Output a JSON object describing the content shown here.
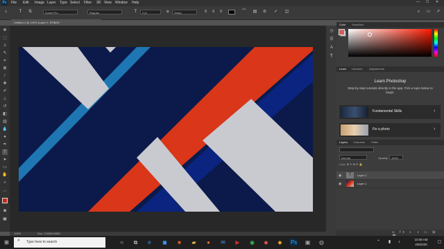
{
  "menubar": {
    "app_icon_label": "Ps",
    "items": [
      "File",
      "Edit",
      "Image",
      "Layer",
      "Type",
      "Select",
      "Filter",
      "3D",
      "View",
      "Window",
      "Help"
    ]
  },
  "optionsbar": {
    "font_family": "Kumei Pro",
    "font_style": "Regular",
    "font_size": "2 pt",
    "antialias": "Sharp",
    "text_color": "#000000"
  },
  "document": {
    "tab_title": "Untitled-1 @ 100% (Layer 2, RGB/8) *",
    "status_zoom": "100%",
    "status_doc": "Doc: 2.64M/3.85M"
  },
  "colors": {
    "navy": "#0b1a4a",
    "deep_blue": "#0a2480",
    "orange_red": "#d9361a",
    "light_gray": "#c9c9d0",
    "teal_blue": "#1e77b3"
  },
  "color_panel": {
    "tabs": [
      "Color",
      "Swatches"
    ]
  },
  "learn_panel": {
    "tabs": [
      "Learn",
      "Libraries",
      "Adjustments"
    ],
    "title": "Learn Photoshop",
    "description": "Step-by-step tutorials directly in the app. Pick a topic below to begin.",
    "cards": [
      {
        "label": "Fundamental Skills"
      },
      {
        "label": "Fix a photo"
      }
    ]
  },
  "layers_panel": {
    "tabs": [
      "Layers",
      "Channels",
      "Paths"
    ],
    "blend_mode": "Normal",
    "opacity_label": "Opacity:",
    "opacity_value": "100%",
    "layers": [
      {
        "name": "Layer 2",
        "thumb": "T"
      },
      {
        "name": "Layer 1",
        "thumb": ""
      }
    ]
  },
  "taskbar": {
    "search_placeholder": "Type here to search",
    "time": "10:08 AM",
    "date": "4/8/2020"
  }
}
